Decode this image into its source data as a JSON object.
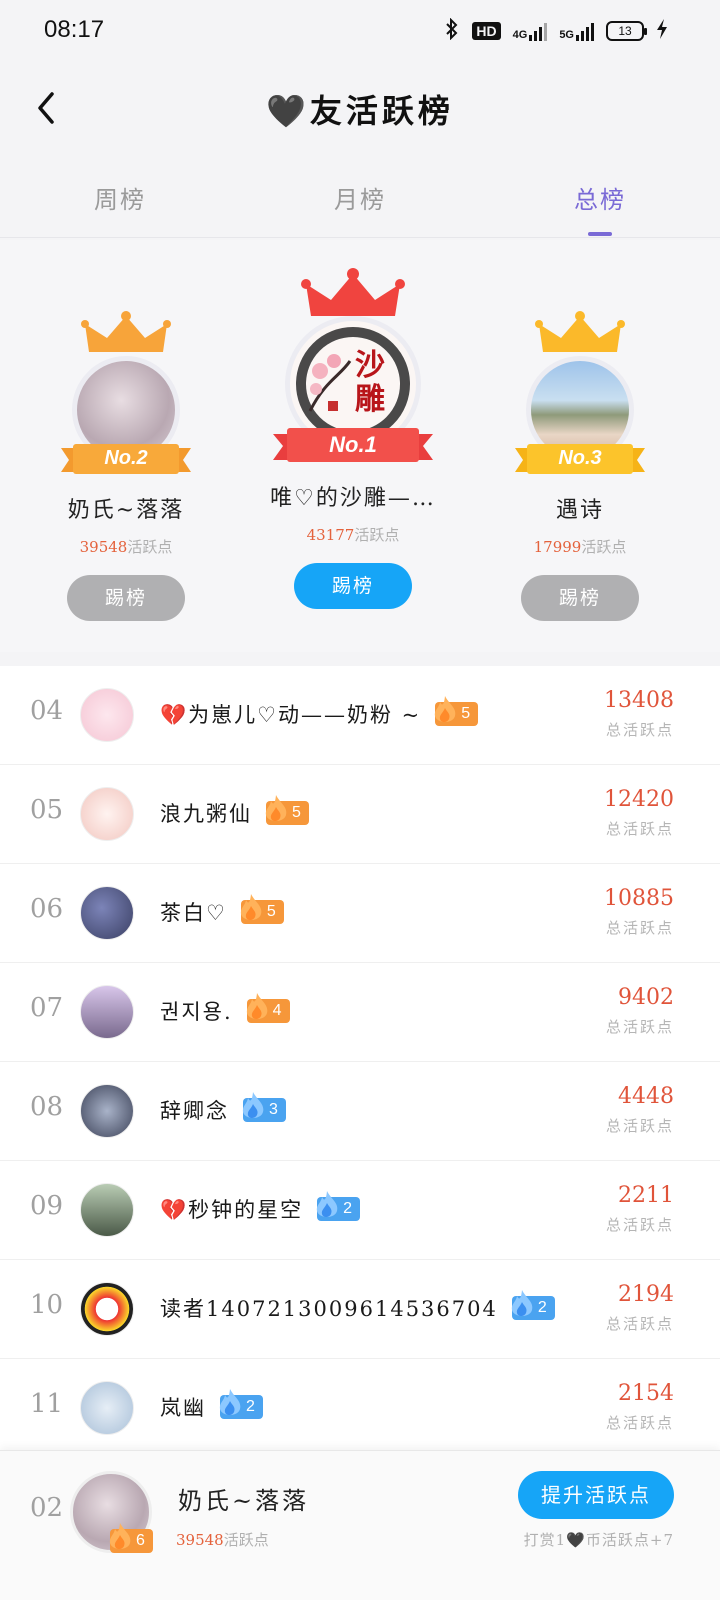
{
  "status_bar": {
    "time": "08:17",
    "hd_label": "HD",
    "net_4g": "4G",
    "net_5g": "5G",
    "battery": "13"
  },
  "header": {
    "title": "🖤友活跃榜"
  },
  "tabs": [
    {
      "label": "周榜",
      "active": false
    },
    {
      "label": "月榜",
      "active": false
    },
    {
      "label": "总榜",
      "active": true
    }
  ],
  "podium": {
    "first": {
      "badge": "No.1",
      "name": "唯♡的沙雕—…",
      "points": "43177",
      "points_label": "活跃点",
      "button": "踢榜",
      "avatar_text": "沙雕"
    },
    "second": {
      "badge": "No.2",
      "name": "奶氏~落落",
      "points": "39548",
      "points_label": "活跃点",
      "button": "踢榜"
    },
    "third": {
      "badge": "No.3",
      "name": "遇诗",
      "points": "17999",
      "points_label": "活跃点",
      "button": "踢榜"
    }
  },
  "list": [
    {
      "rank": "04",
      "name": "💔为崽儿♡动——奶粉 ~",
      "level": "5",
      "level_color": "orange",
      "score": "13408",
      "score_label": "总活跃点"
    },
    {
      "rank": "05",
      "name": "浪九粥仙",
      "level": "5",
      "level_color": "orange",
      "score": "12420",
      "score_label": "总活跃点"
    },
    {
      "rank": "06",
      "name": "茶白♡",
      "level": "5",
      "level_color": "orange",
      "score": "10885",
      "score_label": "总活跃点"
    },
    {
      "rank": "07",
      "name": "권지용.",
      "level": "4",
      "level_color": "orange",
      "score": "9402",
      "score_label": "总活跃点"
    },
    {
      "rank": "08",
      "name": "辞卿念",
      "level": "3",
      "level_color": "blue",
      "score": "4448",
      "score_label": "总活跃点"
    },
    {
      "rank": "09",
      "name": "💔秒钟的星空",
      "level": "2",
      "level_color": "blue",
      "score": "2211",
      "score_label": "总活跃点"
    },
    {
      "rank": "10",
      "name": "读者140721300961453670‌4",
      "level": "2",
      "level_color": "blue",
      "score": "2194",
      "score_label": "总活跃点"
    },
    {
      "rank": "11",
      "name": "岚幽",
      "level": "2",
      "level_color": "blue",
      "score": "2154",
      "score_label": "总活跃点"
    }
  ],
  "my_rank": {
    "rank": "02",
    "name": "奶氏~落落",
    "level": "6",
    "points": "39548",
    "points_label": "活跃点",
    "boost_button": "提升活跃点",
    "reward_text": "打赏1🖤币活跃点+7"
  },
  "colors": {
    "accent_purple": "#7a6ad6",
    "primary_blue": "#16a5f7",
    "score_red": "#e0543a",
    "level_orange": "#f6973a",
    "level_blue": "#4aa3f0"
  }
}
